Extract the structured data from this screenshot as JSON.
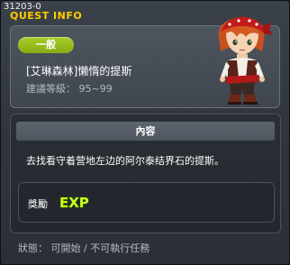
{
  "window": {
    "quest_id": "31203-0",
    "title": "QUEST INFO"
  },
  "quest": {
    "category": "一般",
    "name": "[艾琳森林]懒惰的提斯",
    "level_label": "建議等級",
    "level_separator": "：",
    "level_range": "95~99",
    "npc_icon": "pirate-npc-portrait"
  },
  "content": {
    "header": "內容",
    "description": "去找看守着营地左边的阿尔泰结界石的提斯。"
  },
  "reward": {
    "label": "獎勵",
    "exp_icon": "exp-icon",
    "exp_text": "EXP"
  },
  "status": {
    "label": "狀態",
    "separator": "：",
    "value": "可開始 / 不可執行任務"
  },
  "colors": {
    "title": "#ffcc00",
    "badge": "#97bd1c",
    "exp_text": "#c8ff1e",
    "exp_outline": "#2c4a00"
  }
}
